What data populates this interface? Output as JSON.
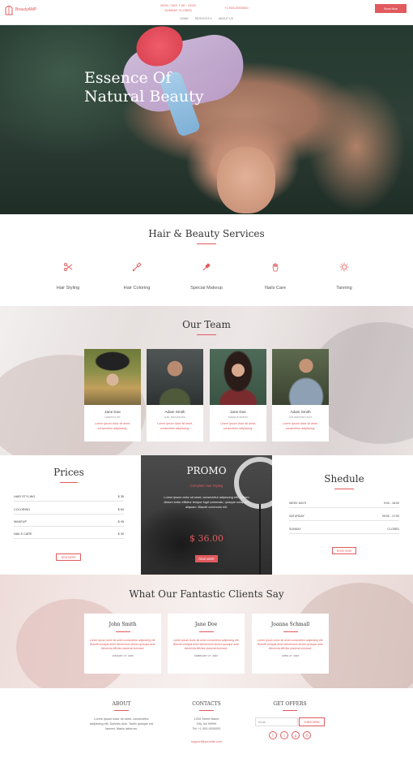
{
  "header": {
    "logo_text": "BeautyAMP",
    "hours_line1": "MON - SAT: 7:00 - 19:00",
    "hours_line2": "SUNDAY CLOSED",
    "phone": "+1 000-0000000",
    "nav": [
      "HOME",
      "SERVICES ▾",
      "ABOUT US"
    ],
    "book_button": "Book Now"
  },
  "hero": {
    "title_line1": "Essence Of",
    "title_line2": "Natural Beauty"
  },
  "services": {
    "title": "Hair & Beauty Services",
    "items": [
      {
        "label": "Hair Styling",
        "icon": "scissors-icon"
      },
      {
        "label": "Hair Coloring",
        "icon": "brush-icon"
      },
      {
        "label": "Special Makeup",
        "icon": "lipstick-icon"
      },
      {
        "label": "Nails Care",
        "icon": "hand-icon"
      },
      {
        "label": "Tanning",
        "icon": "sun-icon"
      }
    ]
  },
  "team": {
    "title": "Our Team",
    "members": [
      {
        "name": "Jane Doe",
        "role": "HAIRSTYLIST",
        "text": "Lorem ipsum dolor sit amet, consectetur adipiscing."
      },
      {
        "name": "Adam Smith",
        "role": "NAIL TECHNICIAN",
        "text": "Lorem ipsum dolor sit amet, consectetur adipiscing."
      },
      {
        "name": "Jane Doe",
        "role": "MAKEUP ARTIST",
        "text": "Lorem ipsum dolor sit amet, consectetur adipiscing."
      },
      {
        "name": "Adam Smith",
        "role": "COLORIST/STYLIST",
        "text": "Lorem ipsum dolor sit amet, consectetur adipiscing."
      }
    ]
  },
  "prices": {
    "title": "Prices",
    "rows": [
      {
        "item": "HAIR STYLING",
        "price": "$ 35"
      },
      {
        "item": "COLORING",
        "price": "$ 60"
      },
      {
        "item": "MAKEUP",
        "price": "$ 45"
      },
      {
        "item": "NAILS CARE",
        "price": "$ 30"
      }
    ],
    "button": "VIEW MORE"
  },
  "promo": {
    "title": "PROMO",
    "subtitle": "Complete Hair Styling",
    "text": "Lorem ipsum dolor sit amet, consectetur adipiscing elit. Nullam dictum tortor efficitur tempor fugit commodo, quisque nosquam aliquam. Blandit commodo elit.",
    "price": "$ 36.00",
    "button": "READ MORE"
  },
  "schedule": {
    "title": "Shedule",
    "rows": [
      {
        "day": "WEEK DAYS",
        "hours": "9:00 - 18:00"
      },
      {
        "day": "SATURDAY",
        "hours": "09:00 - 17:00"
      },
      {
        "day": "SUNDAY",
        "hours": "CLOSED"
      }
    ],
    "button": "BOOK NOW"
  },
  "testimonials": {
    "title": "What Our Fantastic Clients Say",
    "items": [
      {
        "name": "John Smith",
        "text": "Lorem ipsum dolor sit amet consectetur adipiscing elit. Blandit volutpat amet elementum dictum quisque ante elementa efficitur placerat euismod.",
        "date": "JANUARY 27, 2020"
      },
      {
        "name": "Jane Doe",
        "text": "Lorem ipsum dolor sit amet consectetur adipiscing elit. Blandit volutpat amet elementum dictum quisque ante elementa efficitur placerat euismod.",
        "date": "FEBRUARY 27, 2020"
      },
      {
        "name": "Joanna Schmall",
        "text": "Lorem ipsum dolor sit amet consectetur adipiscing elit. Blandit volutpat amet elementum dictum quisque ante elementa efficitur placerat euismod.",
        "date": "APRIL 27, 2020"
      }
    ]
  },
  "footer": {
    "about_title": "ABOUT",
    "about_text": "Lorem ipsum dolor sit amet, consectetur adipiscing elit. Dafotrix duis. Taufix quisque est laoreet, Mauis laborum.",
    "contacts_title": "CONTACTS",
    "contacts_address": "1234 Street Name",
    "contacts_city": "City, AA 99999",
    "contacts_phone": "Tel: +1 000-0000000",
    "contacts_email": "support@yoursite.com",
    "offers_title": "GET OFFERS",
    "email_placeholder": "Email",
    "subscribe_button": "SUBSCRIBE",
    "social": [
      {
        "icon": "facebook-icon",
        "glyph": "f"
      },
      {
        "icon": "twitter-icon",
        "glyph": "t"
      },
      {
        "icon": "pinterest-icon",
        "glyph": "p"
      },
      {
        "icon": "instagram-icon",
        "glyph": "◎"
      }
    ]
  },
  "colors": {
    "accent": "#e05a5e",
    "dark": "#333333"
  }
}
